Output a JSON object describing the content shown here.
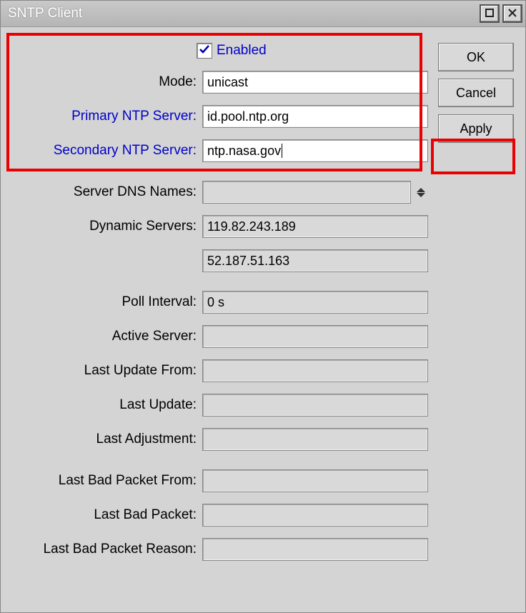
{
  "window": {
    "title": "SNTP Client"
  },
  "buttons": {
    "ok": "OK",
    "cancel": "Cancel",
    "apply": "Apply"
  },
  "form": {
    "enabled_label": "Enabled",
    "enabled_checked": true,
    "mode_label": "Mode:",
    "mode_value": "unicast",
    "primary_label": "Primary NTP Server:",
    "primary_value": "id.pool.ntp.org",
    "secondary_label": "Secondary NTP Server:",
    "secondary_value": "ntp.nasa.gov",
    "dns_label": "Server DNS Names:",
    "dns_value": "",
    "dynamic_label": "Dynamic Servers:",
    "dynamic1": "119.82.243.189",
    "dynamic2": "52.187.51.163",
    "poll_label": "Poll Interval:",
    "poll_value": "0 s",
    "active_label": "Active Server:",
    "active_value": "",
    "last_update_from_label": "Last Update From:",
    "last_update_from_value": "",
    "last_update_label": "Last Update:",
    "last_update_value": "",
    "last_adj_label": "Last Adjustment:",
    "last_adj_value": "",
    "bad_from_label": "Last Bad Packet From:",
    "bad_from_value": "",
    "bad_packet_label": "Last Bad Packet:",
    "bad_packet_value": "",
    "bad_reason_label": "Last Bad Packet Reason:",
    "bad_reason_value": ""
  }
}
